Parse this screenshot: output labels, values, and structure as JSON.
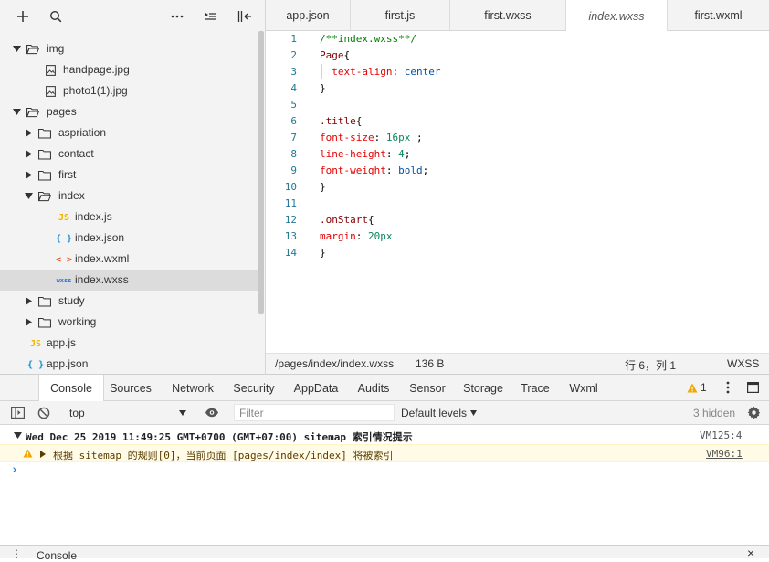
{
  "left_toolbar": {
    "icons": [
      "plus-icon",
      "search-icon",
      "more-icon",
      "collapse-lines-icon",
      "panel-toggle-icon"
    ]
  },
  "tree": {
    "rows": [
      {
        "label": "img",
        "type": "folder",
        "expanded": true
      },
      {
        "label": "handpage.jpg",
        "type": "image"
      },
      {
        "label": "photo1(1).jpg",
        "type": "image"
      },
      {
        "label": "pages",
        "type": "folder",
        "expanded": true
      },
      {
        "label": "aspriation",
        "type": "folder",
        "expanded": false
      },
      {
        "label": "contact",
        "type": "folder",
        "expanded": false
      },
      {
        "label": "first",
        "type": "folder",
        "expanded": false
      },
      {
        "label": "index",
        "type": "folder",
        "expanded": true
      },
      {
        "label": "index.js",
        "type": "js",
        "badge": "JS"
      },
      {
        "label": "index.json",
        "type": "json",
        "badge": "{ }"
      },
      {
        "label": "index.wxml",
        "type": "wxml",
        "badge": "< >"
      },
      {
        "label": "index.wxss",
        "type": "wxss",
        "badge": "wxss",
        "selected": true
      },
      {
        "label": "study",
        "type": "folder",
        "expanded": false
      },
      {
        "label": "working",
        "type": "folder",
        "expanded": false
      },
      {
        "label": "app.js",
        "type": "js",
        "badge": "JS"
      },
      {
        "label": "app.json",
        "type": "json",
        "badge": "{ }"
      }
    ]
  },
  "tabs": [
    {
      "label": "app.json"
    },
    {
      "label": "first.js"
    },
    {
      "label": "first.wxss"
    },
    {
      "label": "index.wxss",
      "active": true
    },
    {
      "label": "first.wxml"
    }
  ],
  "editor": {
    "lines": [
      {
        "n": "1",
        "parts": [
          [
            "c-comment",
            "/**index.wxss**/"
          ]
        ]
      },
      {
        "n": "2",
        "parts": [
          [
            "c-sel",
            "Page"
          ],
          [
            "c-punc",
            "{"
          ]
        ]
      },
      {
        "n": "3",
        "parts": [
          [
            "c-punc",
            "  "
          ],
          [
            "c-prop",
            "text-align"
          ],
          [
            "c-punc",
            ": "
          ],
          [
            "c-val",
            "center"
          ]
        ]
      },
      {
        "n": "4",
        "parts": [
          [
            "c-punc",
            "}"
          ]
        ]
      },
      {
        "n": "5",
        "parts": []
      },
      {
        "n": "6",
        "parts": [
          [
            "c-sel",
            ".title"
          ],
          [
            "c-punc",
            "{"
          ]
        ]
      },
      {
        "n": "7",
        "parts": [
          [
            "c-prop",
            "font-size"
          ],
          [
            "c-punc",
            ": "
          ],
          [
            "c-num",
            "16px"
          ],
          [
            "c-punc",
            " ;"
          ]
        ]
      },
      {
        "n": "8",
        "parts": [
          [
            "c-prop",
            "line-height"
          ],
          [
            "c-punc",
            ": "
          ],
          [
            "c-num",
            "4"
          ],
          [
            "c-punc",
            ";"
          ]
        ]
      },
      {
        "n": "9",
        "parts": [
          [
            "c-prop",
            "font-weight"
          ],
          [
            "c-punc",
            ": "
          ],
          [
            "c-val",
            "bold"
          ],
          [
            "c-punc",
            ";"
          ]
        ]
      },
      {
        "n": "10",
        "parts": [
          [
            "c-punc",
            "}"
          ]
        ]
      },
      {
        "n": "11",
        "parts": []
      },
      {
        "n": "12",
        "parts": [
          [
            "c-sel",
            ".onStart"
          ],
          [
            "c-punc",
            "{"
          ]
        ]
      },
      {
        "n": "13",
        "parts": [
          [
            "c-prop",
            "margin"
          ],
          [
            "c-punc",
            ": "
          ],
          [
            "c-num",
            "20px"
          ]
        ]
      },
      {
        "n": "14",
        "parts": [
          [
            "c-punc",
            "}"
          ]
        ]
      }
    ]
  },
  "statusbar": {
    "path": "/pages/index/index.wxss",
    "size": "136 B",
    "position": "行 6，列 1",
    "language": "WXSS"
  },
  "devtools": {
    "tabs": [
      "Console",
      "Sources",
      "Network",
      "Security",
      "AppData",
      "Audits",
      "Sensor",
      "Storage",
      "Trace",
      "Wxml"
    ],
    "active_tab": "Console",
    "warning_count": "1"
  },
  "console_toolbar": {
    "context": "top",
    "filter_placeholder": "Filter",
    "levels": "Default levels",
    "hidden": "3 hidden"
  },
  "console": {
    "group_text": "Wed Dec 25 2019 11:49:25 GMT+0700 (GMT+07:00) sitemap 索引情况提示",
    "group_link": "VM125:4",
    "warn_text": "根据 sitemap 的规则[0]，当前页面 [pages/index/index] 将被索引",
    "warn_link": "VM96:1",
    "prompt": "›"
  },
  "drawer": {
    "label": "Console",
    "close": "×"
  },
  "colors": {
    "accent_blue": "#1a73e8",
    "warning_yellow": "#f2a600",
    "panel_bg": "#f3f3f3"
  }
}
